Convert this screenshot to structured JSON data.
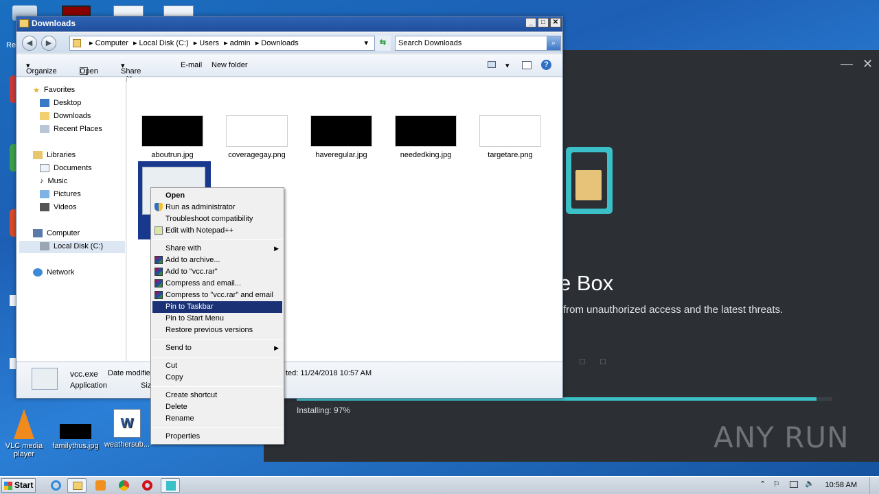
{
  "desktop": {
    "icons": [
      {
        "label": "VLC media player"
      },
      {
        "label": "familythus.jpg"
      },
      {
        "label": "weathersub..."
      }
    ],
    "edge_fragment": "Re"
  },
  "installer": {
    "title_fragment": "e Box",
    "subtitle_fragment": "from unauthorized access and the latest threats.",
    "status": "Installing: 97%",
    "progress": 0.97,
    "watermark": "ANY RUN",
    "accent_color": "#3bc0c8"
  },
  "explorer": {
    "title": "Downloads",
    "breadcrumbs": [
      "Computer",
      "Local Disk (C:)",
      "Users",
      "admin",
      "Downloads"
    ],
    "search_placeholder": "Search Downloads",
    "toolbar": {
      "organize": "Organize",
      "open": "Open",
      "share_with": "Share with",
      "email": "E-mail",
      "new_folder": "New folder"
    },
    "nav": {
      "favorites": "Favorites",
      "desktop": "Desktop",
      "downloads": "Downloads",
      "recent_places": "Recent Places",
      "libraries": "Libraries",
      "documents": "Documents",
      "music": "Music",
      "pictures": "Pictures",
      "videos": "Videos",
      "computer": "Computer",
      "local_disk": "Local Disk (C:)",
      "network": "Network"
    },
    "files": [
      {
        "name": "aboutrun.jpg"
      },
      {
        "name": "coveragegay.png"
      },
      {
        "name": "haveregular.jpg"
      },
      {
        "name": "neededking.jpg"
      },
      {
        "name": "targetare.png"
      }
    ],
    "details": {
      "name": "vcc.exe",
      "type": "Application",
      "date_modified_label": "Date modifie",
      "size_label": "Siz",
      "created": "ted:  11/24/2018 10:57 AM"
    }
  },
  "context_menu": {
    "items": [
      "Open",
      "Run as administrator",
      "Troubleshoot compatibility",
      "Edit with Notepad++",
      "Share with",
      "Add to archive...",
      "Add to \"vcc.rar\"",
      "Compress and email...",
      "Compress to \"vcc.rar\" and email",
      "Pin to Taskbar",
      "Pin to Start Menu",
      "Restore previous versions",
      "Send to",
      "Cut",
      "Copy",
      "Create shortcut",
      "Delete",
      "Rename",
      "Properties"
    ],
    "highlighted_index": 9
  },
  "taskbar": {
    "start": "Start",
    "clock": "10:58 AM"
  }
}
